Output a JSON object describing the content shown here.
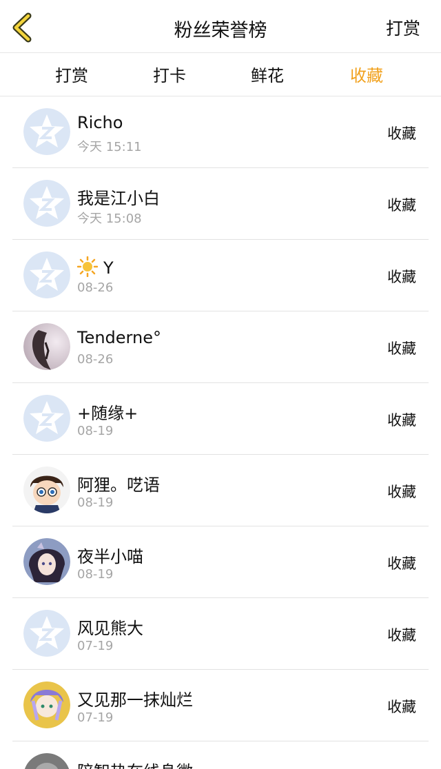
{
  "header": {
    "title": "粉丝荣誉榜",
    "action": "打赏",
    "accent": "#f1a11d"
  },
  "tabs": [
    {
      "label": "打赏"
    },
    {
      "label": "打卡"
    },
    {
      "label": "鲜花"
    },
    {
      "label": "收藏"
    }
  ],
  "rows": [
    {
      "name": "Richo",
      "time": "今天 15:11",
      "action": "收藏",
      "avatar": "default-star-avatar"
    },
    {
      "name": "我是江小白",
      "time": "今天 15:08",
      "action": "收藏",
      "avatar": "default-star-avatar"
    },
    {
      "name": "Y",
      "time": "08-26",
      "action": "收藏",
      "avatar": "default-star-avatar",
      "emoji": "sun-icon"
    },
    {
      "name": "Tenderne°",
      "time": "08-26",
      "action": "收藏",
      "avatar": "photo-avatar"
    },
    {
      "name": "+随缘+",
      "time": "08-19",
      "action": "收藏",
      "avatar": "default-star-avatar"
    },
    {
      "name": "阿狸。呓语",
      "time": "08-19",
      "action": "收藏",
      "avatar": "cartoon-boy-avatar"
    },
    {
      "name": "夜半小喵",
      "time": "08-19",
      "action": "收藏",
      "avatar": "anime-girl-avatar"
    },
    {
      "name": "风见熊大",
      "time": "07-19",
      "action": "收藏",
      "avatar": "default-star-avatar"
    },
    {
      "name": "又见那一抹灿烂",
      "time": "07-19",
      "action": "收藏",
      "avatar": "anime-character-avatar"
    },
    {
      "name": "陪智热在线身微",
      "time": "",
      "action": "",
      "avatar": "photo-avatar"
    }
  ]
}
